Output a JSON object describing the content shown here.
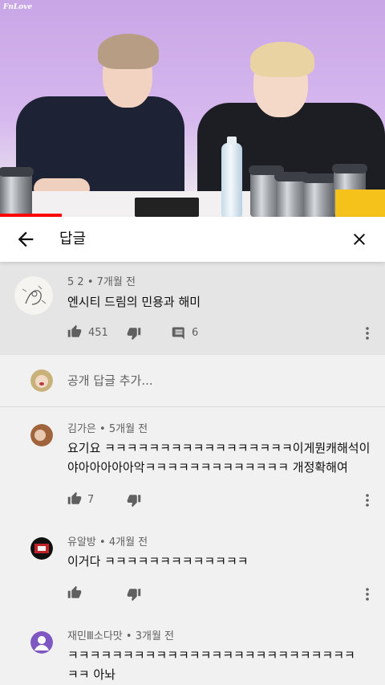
{
  "video": {
    "watermark": "FnLove",
    "progress_percent": 16
  },
  "header": {
    "title": "답글"
  },
  "parent_comment": {
    "author": "5 2",
    "time": "7개월 전",
    "text": "엔시티 드림의 민용과 해미",
    "likes": "451",
    "replies": "6"
  },
  "add_reply": {
    "placeholder": "공개 답글 추가..."
  },
  "replies": [
    {
      "author": "김가은",
      "time": "5개월 전",
      "lines": [
        "요기요 ㅋㅋㅋㅋㅋㅋㅋㅋㅋㅋㅋㅋㅋㅋㅋㅋㅋ이게뭔캐해석이",
        "야아아아아아악ㅋㅋㅋㅋㅋㅋㅋㅋㅋㅋㅋㅋㅋ 개정확해여"
      ],
      "likes": "7",
      "avatar_color": "#a0643c"
    },
    {
      "author": "유알방",
      "time": "4개월 전",
      "lines": [
        "이거다 ㅋㅋㅋㅋㅋㅋㅋㅋㅋㅋㅋㅋㅋ"
      ],
      "likes": "",
      "avatar_color": "#c0242a"
    },
    {
      "author": "재민Ⅲ소다맛",
      "time": "3개월 전",
      "lines": [
        "ㅋㅋㅋㅋㅋㅋㅋㅋㅋㅋㅋㅋㅋㅋㅋㅋㅋㅋㅋㅋㅋㅋㅋㅋㅋㅋ",
        "ㅋㅋ 아놔"
      ],
      "likes": "",
      "avatar_color": "#7e57c2"
    }
  ],
  "colors": {
    "progress": "#ff0000",
    "parent_bg": "#e5e5e5",
    "page_bg": "#f1f1f1"
  }
}
